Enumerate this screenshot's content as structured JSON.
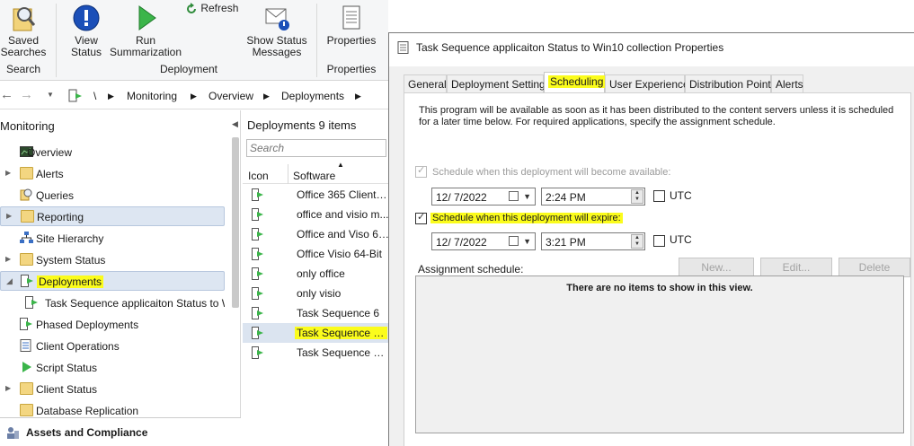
{
  "ribbon": {
    "buttons": [
      {
        "label": "Saved\nSearches",
        "icon": "saved-searches-icon"
      },
      {
        "label": "View\nStatus",
        "icon": "info-icon"
      },
      {
        "label": "Run\nSummarization",
        "icon": "play-icon"
      },
      {
        "label": "Refresh",
        "icon": "refresh-icon"
      },
      {
        "label": "Show Status\nMessages",
        "icon": "status-messages-icon"
      },
      {
        "label": "Properties",
        "icon": "properties-icon"
      }
    ],
    "groups": {
      "search": "Search",
      "deployment": "Deployment",
      "properties": "Properties"
    }
  },
  "address": {
    "root": "\\",
    "crumbs": [
      "Monitoring",
      "Overview",
      "Deployments"
    ]
  },
  "nav": {
    "title": "Monitoring",
    "items": [
      {
        "label": "Overview",
        "icon": "overview-icon"
      },
      {
        "label": "Alerts",
        "icon": "folder-icon"
      },
      {
        "label": "Queries",
        "icon": "queries-icon"
      },
      {
        "label": "Reporting",
        "icon": "folder-icon"
      },
      {
        "label": "Site Hierarchy",
        "icon": "hierarchy-icon"
      },
      {
        "label": "System Status",
        "icon": "folder-icon"
      },
      {
        "label": "Deployments",
        "icon": "deployment-icon"
      },
      {
        "label": "Task Sequence applicaiton Status to W",
        "icon": "deployment-icon"
      },
      {
        "label": "Phased Deployments",
        "icon": "deployment-icon"
      },
      {
        "label": "Client Operations",
        "icon": "client-ops-icon"
      },
      {
        "label": "Script Status",
        "icon": "play-icon"
      },
      {
        "label": "Client Status",
        "icon": "folder-icon"
      },
      {
        "label": "Database Replication",
        "icon": "folder-icon"
      }
    ],
    "bottom": "Assets and Compliance"
  },
  "list": {
    "title": "Deployments 9 items",
    "search_placeholder": "Search",
    "columns": [
      "Icon",
      "Software"
    ],
    "rows": [
      "Office 365 Client U...",
      "office and visio m...",
      "Office and Viso 64...",
      "Office Visio 64-Bit",
      "only office",
      "only visio",
      "Task Sequence 6",
      "Task Sequence ap...",
      "Task Sequence we..."
    ]
  },
  "dialog": {
    "title": "Task Sequence applicaiton Status to Win10 collection Properties",
    "tabs": [
      "General",
      "Deployment Settings",
      "Scheduling",
      "User Experience",
      "Distribution Points",
      "Alerts"
    ],
    "active_tab": "Scheduling",
    "description": "This program will be available as soon as it has been distributed to the content servers unless it is scheduled for a later time below. For required applications, specify the assignment schedule.",
    "available": {
      "label": "Schedule when this deployment will become available:",
      "date": "12/  7/2022",
      "time": "2:24 PM",
      "utc": "UTC"
    },
    "expire": {
      "label": "Schedule when this deployment will expire:",
      "date": "12/  7/2022",
      "time": "3:21 PM",
      "utc": "UTC"
    },
    "assignment_label": "Assignment schedule:",
    "buttons": {
      "new": "New...",
      "edit": "Edit...",
      "delete": "Delete"
    },
    "empty_text": "There are no items to show in this view."
  },
  "colors": {
    "highlight": "#fbfc1c",
    "selection": "#dde6f2",
    "folder": "#f3d681"
  }
}
